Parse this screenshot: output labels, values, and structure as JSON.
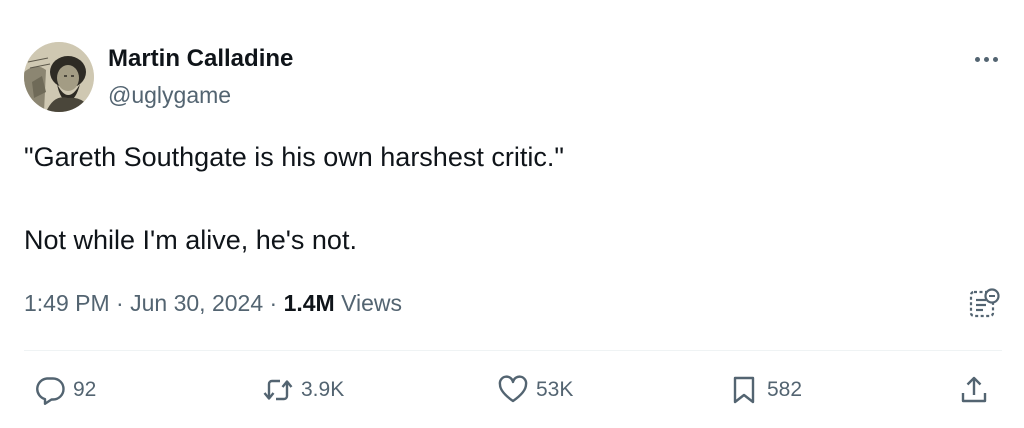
{
  "author": {
    "display_name": "Martin Calladine",
    "handle": "@uglygame"
  },
  "tweet": {
    "line1": "\"Gareth Southgate is his own harshest critic.\"",
    "line2": "Not while I'm alive, he's not."
  },
  "meta": {
    "time": "1:49 PM",
    "separator1": " · ",
    "date": "Jun 30, 2024",
    "separator2": " · ",
    "views_count": "1.4M",
    "views_label": " Views"
  },
  "actions": {
    "replies": "92",
    "reposts": "3.9K",
    "likes": "53K",
    "bookmarks": "582"
  },
  "icons": {
    "more": "more-horizontal-icon",
    "grok": "grok-explain-icon",
    "reply": "reply-bubble-icon",
    "repost": "repost-arrows-icon",
    "like": "heart-icon",
    "bookmark": "bookmark-icon",
    "share": "share-upload-icon"
  },
  "colors": {
    "text_primary": "#0f1419",
    "text_secondary": "#536471",
    "divider": "#eff3f4"
  }
}
